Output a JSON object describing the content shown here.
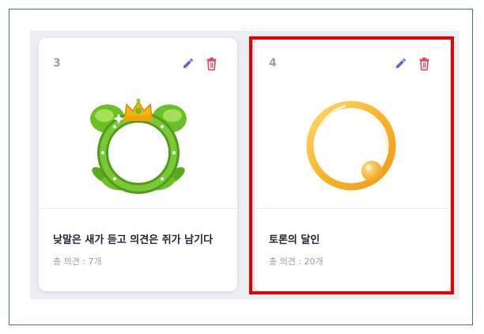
{
  "cards": [
    {
      "number": "3",
      "title": "낮말은 새가 듣고 의견은 쥐가 남기다",
      "opinions": "총 의견 : 7개",
      "badge": "green-wreath-crown-badge",
      "edit_icon": "pencil-icon",
      "delete_icon": "trash-icon"
    },
    {
      "number": "4",
      "title": "토론의 달인",
      "opinions": "총 의견 : 20개",
      "badge": "gold-ring-badge",
      "edit_icon": "pencil-icon",
      "delete_icon": "trash-icon"
    }
  ],
  "colors": {
    "edit": "#5a62e6",
    "delete": "#e0455d",
    "highlight": "#e60000",
    "panel": "#eceef3"
  }
}
